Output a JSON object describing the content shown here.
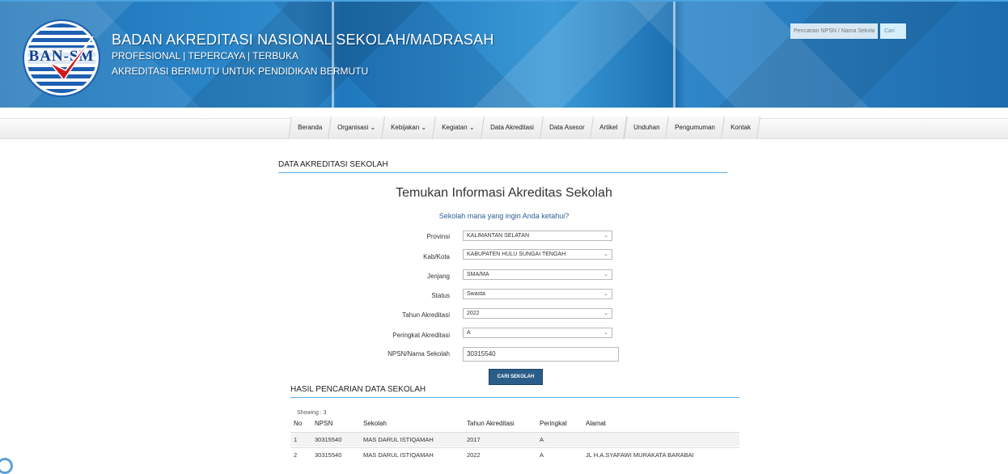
{
  "header": {
    "logo_text": "BAN-SM",
    "title": "BADAN AKREDITASI NASIONAL SEKOLAH/MADRASAH",
    "tagline": "PROFESIONAL | TEPERCAYA  | TERBUKA",
    "motto": "AKREDITASI BERMUTU UNTUK PENDIDIKAN BERMUTU",
    "search_placeholder": "Pencarian NPSN / Nama Sekolah",
    "search_button": "Cari"
  },
  "nav": [
    {
      "label": "Beranda"
    },
    {
      "label": "Organisasi ⌄"
    },
    {
      "label": "Kebijakan ⌄"
    },
    {
      "label": "Kegiatan ⌄"
    },
    {
      "label": "Data Akreditasi"
    },
    {
      "label": "Data Asesor"
    },
    {
      "label": "Artikel"
    },
    {
      "label": "Unduhan"
    },
    {
      "label": "Pengumuman"
    },
    {
      "label": "Kontak"
    }
  ],
  "section_title": "DATA AKREDITASI SEKOLAH",
  "heading": "Temukan Informasi Akreditas Sekolah",
  "subheading": "Sekolah mana yang ingin Anda ketahui?",
  "form": {
    "provinsi": {
      "label": "Provinsi",
      "value": "KALIMANTAN SELATAN"
    },
    "kabkota": {
      "label": "Kab/Kota",
      "value": "KABUPATEN HULU SUNGAI TENGAH"
    },
    "jenjang": {
      "label": "Jenjang",
      "value": "SMA/MA"
    },
    "status": {
      "label": "Status",
      "value": "Swasta"
    },
    "tahun": {
      "label": "Tahun Akreditasi",
      "value": "2022"
    },
    "peringkat": {
      "label": "Peringkat Akreditasi",
      "value": "A"
    },
    "npsn": {
      "label": "NPSN/Nama Sekolah",
      "value": "30315540"
    },
    "submit": "CARI SEKOLAH"
  },
  "results": {
    "title": "HASIL PENCARIAN DATA SEKOLAH",
    "showing": "Showing : 3",
    "columns": [
      "No",
      "NPSN",
      "Sekolah",
      "Tahun Akreditasi",
      "Peringkat",
      "Alamat"
    ],
    "rows": [
      [
        "1",
        "30315540",
        "MAS DARUL ISTIQAMAH",
        "2017",
        "A",
        ""
      ],
      [
        "2",
        "30315540",
        "MAS DARUL ISTIQAMAH",
        "2022",
        "A",
        "JL H.A.SYAFAWI MURAKATA BARABAI"
      ]
    ]
  },
  "colors": {
    "accent": "#2b5d89",
    "banner": "#1f78bd",
    "rule": "#5aaee6"
  }
}
